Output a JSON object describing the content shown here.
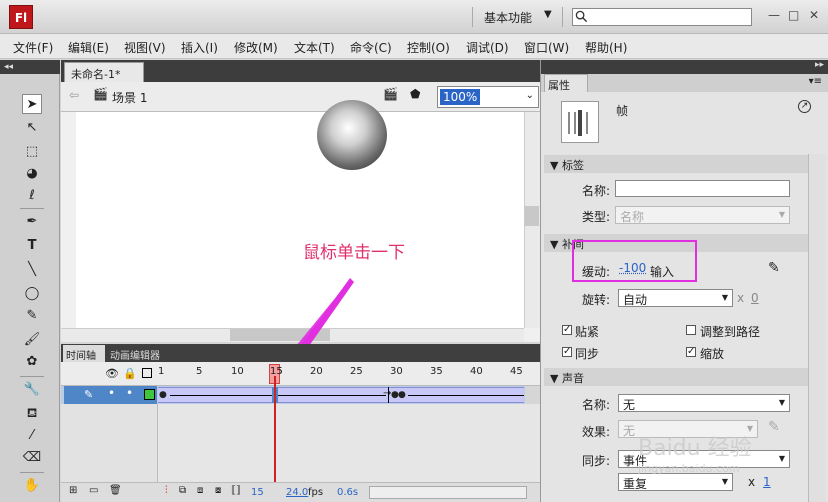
{
  "title_bar": {
    "logo": "Fl",
    "workspace": "基本功能",
    "search_placeholder": "",
    "minimize": "—",
    "restore": "□",
    "close": "✕"
  },
  "menu": [
    "文件(F)",
    "编辑(E)",
    "视图(V)",
    "插入(I)",
    "修改(M)",
    "文本(T)",
    "命令(C)",
    "控制(O)",
    "调试(D)",
    "窗口(W)",
    "帮助(H)"
  ],
  "document": {
    "tab_label": "未命名-1*",
    "tab_close": "✕",
    "scene": "场景 1",
    "zoom": "100%"
  },
  "annotation": "鼠标单击一下",
  "timeline": {
    "tabs": [
      "时间轴",
      "动画编辑器"
    ],
    "frame_numbers": [
      "1",
      "5",
      "10",
      "15",
      "20",
      "25",
      "30",
      "35",
      "40",
      "45"
    ],
    "current_frame": "15",
    "fps": "24.0",
    "fps_unit": "fps",
    "time": "0.6s"
  },
  "properties": {
    "tab": "属性",
    "type_label": "帧",
    "sections": {
      "label": "标签",
      "tween": "补间",
      "sound": "声音"
    },
    "name_label": "名称:",
    "name_value": "",
    "type_field_label": "类型:",
    "type_value": "名称",
    "ease_label": "缓动:",
    "ease_value": "-100",
    "ease_unit": "输入",
    "rotate_label": "旋转:",
    "rotate_value": "自动",
    "rotate_times": "x",
    "rotate_count": "0",
    "checkboxes": {
      "snap": "贴紧",
      "orient": "调整到路径",
      "sync": "同步",
      "scale": "缩放"
    },
    "sound_name_label": "名称:",
    "sound_name_value": "无",
    "effect_label": "效果:",
    "effect_value": "无",
    "sync_label": "同步:",
    "sync_value": "事件",
    "repeat_value": "重复",
    "repeat_times": "x",
    "repeat_count": "1"
  },
  "watermark": "Baidu 经验",
  "watermark_sub": "jingyan.baidu.com",
  "colors": {
    "accent": "#2a64c6",
    "annotation": "#e0306e",
    "highlight": "#e02ee0",
    "playhead": "#d12020",
    "frames": "#c7c8f8"
  }
}
